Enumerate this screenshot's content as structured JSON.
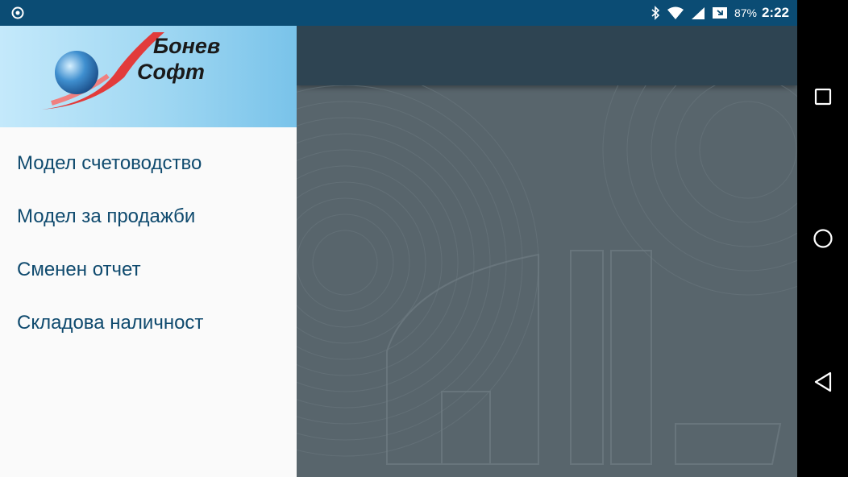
{
  "status_bar": {
    "battery_percent": "87%",
    "time": "2:22",
    "icons": [
      "notification-circle-icon",
      "bluetooth-icon",
      "wifi-icon",
      "signal-icon",
      "battery-icon"
    ]
  },
  "drawer": {
    "logo": {
      "line1": "Бонев",
      "line2": "Софт"
    },
    "items": [
      {
        "label": "Модел счетоводство"
      },
      {
        "label": "Модел за продажби"
      },
      {
        "label": "Сменен отчет"
      },
      {
        "label": "Складова наличност"
      }
    ]
  },
  "nav_bar": {
    "icons": [
      "recents-icon",
      "home-icon",
      "back-icon"
    ]
  },
  "colors": {
    "status_bar": "#0b4c74",
    "toolbar": "#2e4452",
    "scrim": "#58656c",
    "menu_text": "#0f4a6e",
    "header_gradient_start": "#c4e9fb",
    "header_gradient_end": "#79c3ea"
  }
}
